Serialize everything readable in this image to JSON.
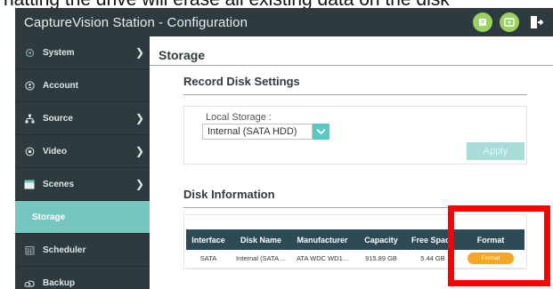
{
  "caption": "natting the drive will erase all existing data on the disk",
  "window": {
    "title": "CaptureVision Station - Configuration"
  },
  "header_icons": [
    "info-icon",
    "play-icon",
    "logout-icon"
  ],
  "sidebar": {
    "items": [
      {
        "label": "System",
        "icon": "gear-icon",
        "has_submenu": true,
        "active": false
      },
      {
        "label": "Account",
        "icon": "user-icon",
        "has_submenu": false,
        "active": false
      },
      {
        "label": "Source",
        "icon": "network-icon",
        "has_submenu": true,
        "active": false
      },
      {
        "label": "Video",
        "icon": "video-icon",
        "has_submenu": true,
        "active": false
      },
      {
        "label": "Scenes",
        "icon": "scenes-icon",
        "has_submenu": true,
        "active": false
      },
      {
        "label": "Storage",
        "icon": "",
        "has_submenu": false,
        "active": true
      },
      {
        "label": "Scheduler",
        "icon": "calendar-icon",
        "has_submenu": false,
        "active": false
      },
      {
        "label": "Backup",
        "icon": "backup-icon",
        "has_submenu": false,
        "active": false
      }
    ]
  },
  "main": {
    "page_title": "Storage",
    "record": {
      "title": "Record Disk Settings",
      "local_storage_label": "Local Storage :",
      "local_storage_value": "Internal (SATA HDD)",
      "apply_label": "Apply"
    },
    "disk": {
      "title": "Disk Information",
      "columns": [
        "Interface",
        "Disk Name",
        "Manufacturer",
        "Capacity",
        "Free Space",
        "Format"
      ],
      "rows": [
        {
          "interface": "SATA",
          "disk_name": "Internal (SATA ...",
          "manufacturer": "ATA WDC WD1...",
          "capacity": "915.89 GB",
          "free_space": "5.44 GB",
          "format_label": "Format"
        }
      ]
    }
  },
  "colors": {
    "titlebar": "#2d3a3e",
    "sidebar": "#2d3b3f",
    "active_item": "#78c6c0",
    "accent": "#5ac9c0",
    "table_header": "#2e4a56",
    "format_button": "#f5a623",
    "highlight": "#ff0000"
  }
}
